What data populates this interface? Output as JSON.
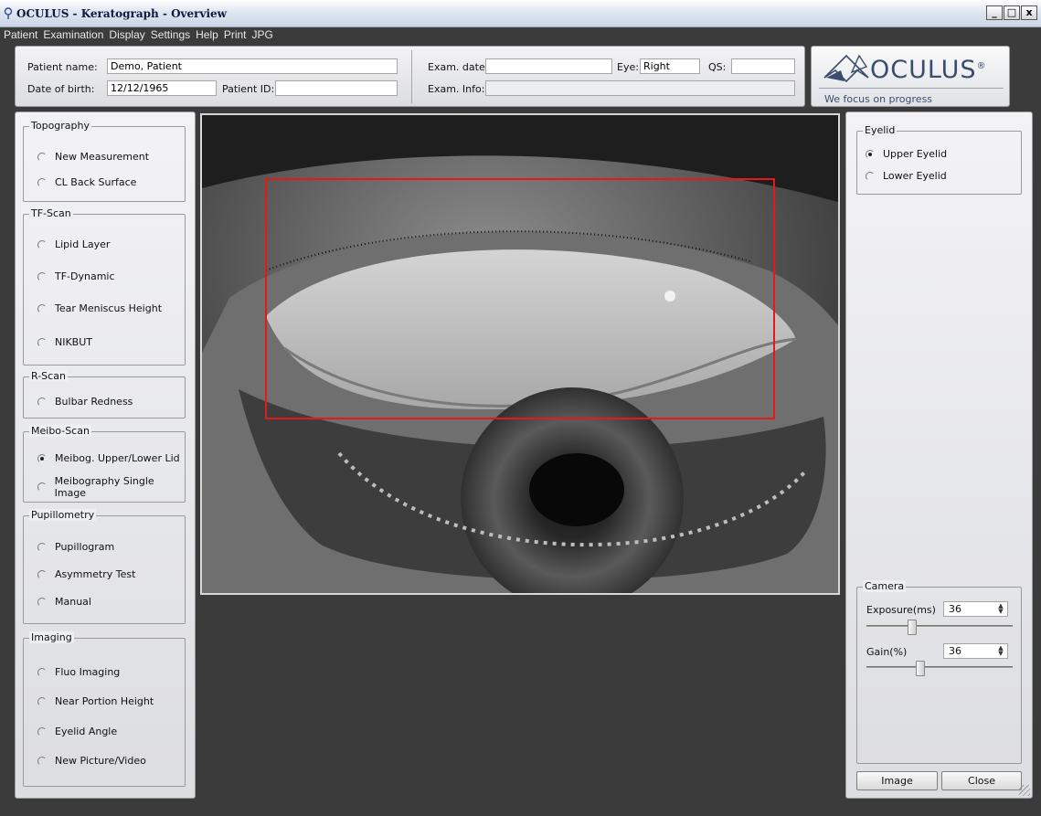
{
  "window": {
    "title": "OCULUS - Keratograph - Overview",
    "controls": [
      "_",
      "□",
      "x"
    ]
  },
  "menu": [
    "Patient",
    "Examination",
    "Display",
    "Settings",
    "Help",
    "Print",
    "JPG"
  ],
  "patient": {
    "name_label": "Patient name:",
    "name_value": "Demo, Patient",
    "dob_label": "Date of birth:",
    "dob_value": "12/12/1965",
    "id_label": "Patient ID:",
    "id_value": ""
  },
  "exam": {
    "date_label": "Exam. date:",
    "date_value": "",
    "eye_label": "Eye:",
    "eye_value": "Right",
    "qs_label": "QS:",
    "qs_value": "",
    "info_label": "Exam. Info:",
    "info_value": ""
  },
  "logo": {
    "brand": "OCULUS",
    "registered": "®",
    "tagline": "We focus on progress",
    "colors": {
      "brand": "#3a4d6e"
    }
  },
  "left_groups": {
    "topography": {
      "title": "Topography",
      "items": [
        "New Measurement",
        "CL Back Surface"
      ]
    },
    "tfscan": {
      "title": "TF-Scan",
      "items": [
        "Lipid Layer",
        "TF-Dynamic",
        "Tear Meniscus Height",
        "NIKBUT"
      ]
    },
    "rscan": {
      "title": "R-Scan",
      "items": [
        "Bulbar Redness"
      ]
    },
    "meiboscan": {
      "title": "Meibo-Scan",
      "items": [
        "Meibog. Upper/Lower Lid",
        "Meibography Single Image"
      ],
      "selected": "Meibog. Upper/Lower Lid"
    },
    "pupillometry": {
      "title": "Pupillometry",
      "items": [
        "Pupillogram",
        "Asymmetry Test",
        "Manual"
      ]
    },
    "imaging": {
      "title": "Imaging",
      "items": [
        "Fluo Imaging",
        "Near Portion Height",
        "Eyelid Angle",
        "New Picture/Video"
      ]
    }
  },
  "eyelid": {
    "title": "Eyelid",
    "items": [
      "Upper Eyelid",
      "Lower Eyelid"
    ],
    "selected": "Upper Eyelid"
  },
  "camera": {
    "title": "Camera",
    "exposure_label": "Exposure(ms)",
    "exposure_value": "36",
    "exposure_slider_fraction": 0.3,
    "gain_label": "Gain(%)",
    "gain_value": "36",
    "gain_slider_fraction": 0.36
  },
  "buttons": {
    "image": "Image",
    "close": "Close"
  },
  "colors": {
    "roi_box": "#e21a1a",
    "background": "#3b3b3b"
  }
}
